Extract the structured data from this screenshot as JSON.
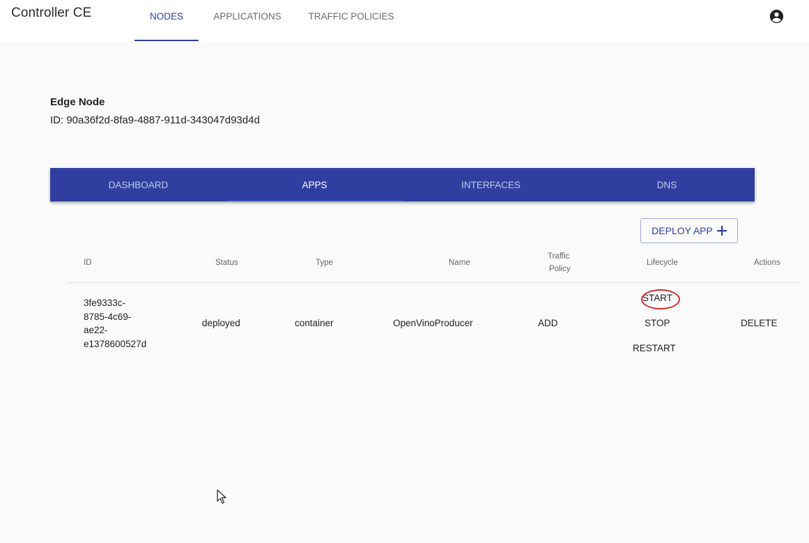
{
  "app": {
    "title": "Controller CE"
  },
  "nav": {
    "tabs": [
      {
        "label": "NODES",
        "active": true
      },
      {
        "label": "APPLICATIONS",
        "active": false
      },
      {
        "label": "TRAFFIC POLICIES",
        "active": false
      }
    ],
    "account_icon": "account-circle-icon"
  },
  "node": {
    "heading": "Edge Node",
    "id_text": "ID: 90a36f2d-8fa9-4887-911d-343047d93d4d"
  },
  "subtabs": [
    {
      "label": "DASHBOARD",
      "active": false
    },
    {
      "label": "APPS",
      "active": true
    },
    {
      "label": "INTERFACES",
      "active": false
    },
    {
      "label": "DNS",
      "active": false
    }
  ],
  "deploy": {
    "label": "DEPLOY APP",
    "icon": "plus-icon"
  },
  "table": {
    "headers": {
      "id": "ID",
      "status": "Status",
      "type": "Type",
      "name": "Name",
      "traffic_policy_line1": "Traffic",
      "traffic_policy_line2": "Policy",
      "lifecycle": "Lifecycle",
      "actions": "Actions"
    },
    "rows": [
      {
        "id_lines": [
          "3fe9333c-",
          "8785-4c69-",
          "ae22-",
          "e1378600527d"
        ],
        "status": "deployed",
        "type": "container",
        "name": "OpenVinoProducer",
        "traffic_policy": "ADD",
        "lifecycle": [
          "START",
          "STOP",
          "RESTART"
        ],
        "actions": "DELETE"
      }
    ]
  },
  "colors": {
    "primary": "#303f9f",
    "background": "#fafafa",
    "annotation": "#d32f2f"
  }
}
